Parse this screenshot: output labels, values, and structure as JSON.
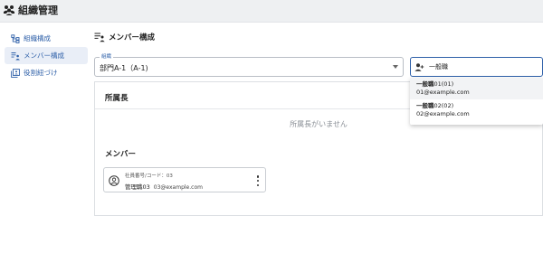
{
  "app": {
    "title": "組織管理",
    "icon": "people-group-icon"
  },
  "sidebar": {
    "items": [
      {
        "label": "組織構成",
        "icon": "org-tree-icon",
        "active": false
      },
      {
        "label": "メンバー構成",
        "icon": "member-list-icon",
        "active": true
      },
      {
        "label": "役割紐づけ",
        "icon": "role-link-icon",
        "active": false
      }
    ]
  },
  "main": {
    "title": "メンバー構成",
    "org_select": {
      "legend": "組織",
      "value": "部門A-1（A-1)"
    },
    "member_search": {
      "value": "一般職"
    },
    "head_section": {
      "title": "所属長",
      "empty_text": "所属長がいません"
    },
    "members_section": {
      "title": "メンバー",
      "cards": [
        {
          "code_line": "社員番号/コード：03",
          "name": "管理職03",
          "email": "03@example.com"
        }
      ]
    }
  },
  "dropdown": {
    "options": [
      {
        "name_bold": "一般職",
        "name_rest": "01(01)",
        "email": "01@example.com"
      },
      {
        "name_bold": "一般職",
        "name_rest": "02(02)",
        "email": "02@example.com"
      }
    ]
  },
  "colors": {
    "accent": "#2d5fa8",
    "background": "#eef0f2",
    "active_item": "#e9eef7"
  }
}
